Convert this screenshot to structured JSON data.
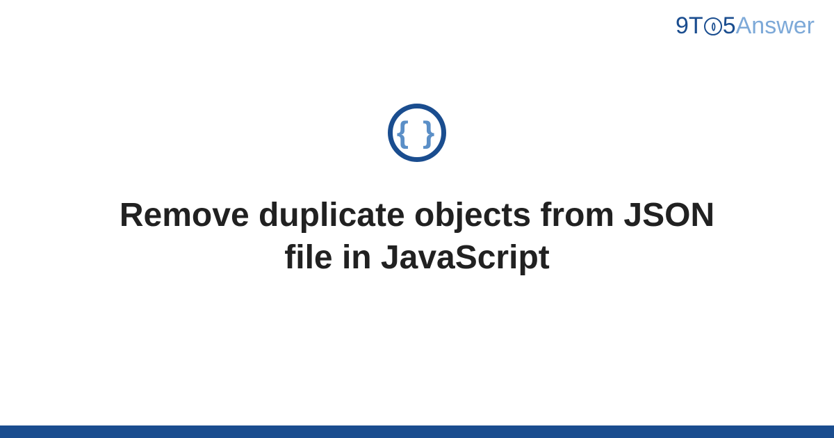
{
  "logo": {
    "part1": "9T",
    "part_o_inner": "()",
    "part2": "5",
    "part3": "Answer"
  },
  "icon": {
    "braces": "{ }"
  },
  "title": "Remove duplicate objects from JSON file in JavaScript"
}
